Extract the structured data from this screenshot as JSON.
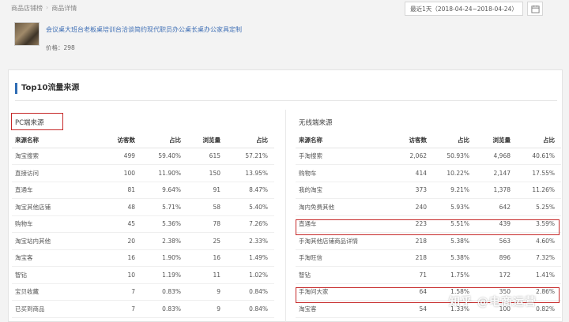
{
  "breadcrumb": {
    "store": "商品店铺榜",
    "detail": "商品详情"
  },
  "date_range": "最近1天（2018-04-24~2018-04-24）",
  "product": {
    "title": "会议桌大班台老板桌培训台洽谈简约现代职员办公桌长桌办公家具定制",
    "price_label": "价格：298"
  },
  "section_title": "Top10流量来源",
  "pc": {
    "title": "PC端来源",
    "headers": [
      "来源名称",
      "访客数",
      "占比",
      "浏览量",
      "占比"
    ],
    "rows": [
      [
        "淘宝搜索",
        "499",
        "59.40%",
        "615",
        "57.21%"
      ],
      [
        "直接访问",
        "100",
        "11.90%",
        "150",
        "13.95%"
      ],
      [
        "直通车",
        "81",
        "9.64%",
        "91",
        "8.47%"
      ],
      [
        "淘宝其他店铺",
        "48",
        "5.71%",
        "58",
        "5.40%"
      ],
      [
        "购物车",
        "45",
        "5.36%",
        "78",
        "7.26%"
      ],
      [
        "淘宝站内其他",
        "20",
        "2.38%",
        "25",
        "2.33%"
      ],
      [
        "淘宝客",
        "16",
        "1.90%",
        "16",
        "1.49%"
      ],
      [
        "智钻",
        "10",
        "1.19%",
        "11",
        "1.02%"
      ],
      [
        "宝贝收藏",
        "7",
        "0.83%",
        "9",
        "0.84%"
      ],
      [
        "已买到商品",
        "7",
        "0.83%",
        "9",
        "0.84%"
      ]
    ]
  },
  "wireless": {
    "title": "无线端来源",
    "headers": [
      "来源名称",
      "访客数",
      "占比",
      "浏览量",
      "占比"
    ],
    "rows": [
      [
        "手淘搜索",
        "2,062",
        "50.93%",
        "4,968",
        "40.61%"
      ],
      [
        "购物车",
        "414",
        "10.22%",
        "2,147",
        "17.55%"
      ],
      [
        "我的淘宝",
        "373",
        "9.21%",
        "1,378",
        "11.26%"
      ],
      [
        "淘内免费其他",
        "240",
        "5.93%",
        "642",
        "5.25%"
      ],
      [
        "直通车",
        "223",
        "5.51%",
        "439",
        "3.59%"
      ],
      [
        "手淘其他店铺商品详情",
        "218",
        "5.38%",
        "563",
        "4.60%"
      ],
      [
        "手淘旺信",
        "218",
        "5.38%",
        "896",
        "7.32%"
      ],
      [
        "智钻",
        "71",
        "1.75%",
        "172",
        "1.41%"
      ],
      [
        "手淘问大家",
        "64",
        "1.58%",
        "350",
        "2.86%"
      ],
      [
        "淘宝客",
        "54",
        "1.33%",
        "100",
        "0.82%"
      ]
    ]
  },
  "watermark": "知乎 @电商运营"
}
